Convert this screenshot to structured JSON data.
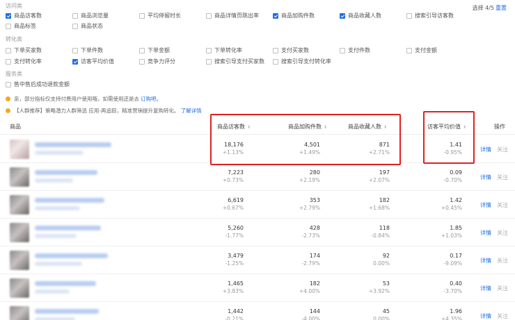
{
  "groups": {
    "access": {
      "title": "访问类",
      "items": [
        {
          "label": "商品访客数",
          "checked": true
        },
        {
          "label": "商品浏览量",
          "checked": false
        },
        {
          "label": "平均停留时长",
          "checked": false
        },
        {
          "label": "商品详情页跳出率",
          "checked": false
        },
        {
          "label": "商品加购件数",
          "checked": true
        },
        {
          "label": "商品收藏人数",
          "checked": true
        },
        {
          "label": "搜索引导访客数",
          "checked": false
        },
        {
          "label": "商品标签",
          "checked": false
        },
        {
          "label": "商品状态",
          "checked": false
        }
      ]
    },
    "conversion": {
      "title": "转化类",
      "items": [
        {
          "label": "下单买家数",
          "checked": false
        },
        {
          "label": "下单件数",
          "checked": false
        },
        {
          "label": "下单金额",
          "checked": false
        },
        {
          "label": "下单转化率",
          "checked": false
        },
        {
          "label": "支付买家数",
          "checked": false
        },
        {
          "label": "支付件数",
          "checked": false
        },
        {
          "label": "支付金额",
          "checked": false
        },
        {
          "label": "支付转化率",
          "checked": false
        },
        {
          "label": "访客平均价值",
          "checked": true
        },
        {
          "label": "竞争力评分",
          "checked": false
        },
        {
          "label": "搜索引导支付买家数",
          "checked": false
        },
        {
          "label": "搜索引导支付转化率",
          "checked": false
        }
      ]
    },
    "service": {
      "title": "服务类",
      "items": [
        {
          "label": "售中售后成功退款金额",
          "checked": false
        }
      ]
    }
  },
  "selection": {
    "count": "选择 4/5",
    "reset": "重置"
  },
  "notices": [
    {
      "text": "亲，部分指标仅支持付费用户使用哦，如需使用还是去",
      "link": "订购吧。"
    },
    {
      "text": "【人群推荐】策略潜力人群筛选 应用-再追踪，精准营销提升复购转化。",
      "link": "了解详情"
    }
  ],
  "table": {
    "columns": {
      "product": "商品",
      "visitors": "商品访客数",
      "cart": "商品加购件数",
      "fav": "商品收藏人数",
      "value": "访客平均价值",
      "ops": "操作"
    },
    "rows": [
      {
        "visitors": "18,176",
        "visitors_c": "+1.13%",
        "cart": "4,501",
        "cart_c": "+1.49%",
        "fav": "871",
        "fav_c": "+2.71%",
        "value": "1.41",
        "value_c": "-0.95%",
        "detail": "详情",
        "follow": "关注"
      },
      {
        "visitors": "7,223",
        "visitors_c": "+0.73%",
        "cart": "280",
        "cart_c": "+2.19%",
        "fav": "197",
        "fav_c": "+2.07%",
        "value": "0.09",
        "value_c": "-0.70%",
        "detail": "详情",
        "follow": "关注"
      },
      {
        "visitors": "6,619",
        "visitors_c": "+0.67%",
        "cart": "353",
        "cart_c": "+2.79%",
        "fav": "182",
        "fav_c": "+1.68%",
        "value": "1.42",
        "value_c": "+0.45%",
        "detail": "详情",
        "follow": "关注"
      },
      {
        "visitors": "5,260",
        "visitors_c": "-1.77%",
        "cart": "428",
        "cart_c": "-2.73%",
        "fav": "118",
        "fav_c": "-0.84%",
        "value": "1.85",
        "value_c": "+1.03%",
        "detail": "详情",
        "follow": "关注"
      },
      {
        "visitors": "3,479",
        "visitors_c": "-1.25%",
        "cart": "174",
        "cart_c": "-2.79%",
        "fav": "92",
        "fav_c": "0.00%",
        "value": "0.17",
        "value_c": "-9.09%",
        "detail": "详情",
        "follow": "关注"
      },
      {
        "visitors": "1,465",
        "visitors_c": "+3.83%",
        "cart": "182",
        "cart_c": "+4.00%",
        "fav": "53",
        "fav_c": "+3.92%",
        "value": "0.40",
        "value_c": "-3.70%",
        "detail": "详情",
        "follow": "关注"
      },
      {
        "visitors": "1,442",
        "visitors_c": "-0.21%",
        "cart": "144",
        "cart_c": "-4.00%",
        "fav": "45",
        "fav_c": "0.00%",
        "value": "1.96",
        "value_c": "+4.35%",
        "detail": "详情",
        "follow": "关注"
      }
    ]
  },
  "colors": {
    "accent": "#1f6fe5",
    "highlight": "#e02020",
    "warning": "#f5a623"
  }
}
